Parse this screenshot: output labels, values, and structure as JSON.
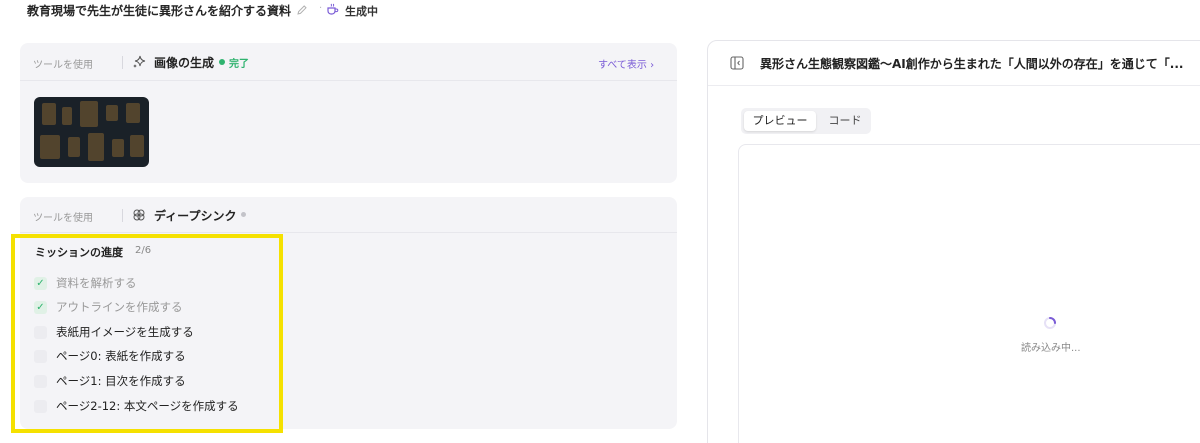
{
  "header": {
    "title": "教育現場で先生が生徒に異形さんを紹介する資料",
    "status": "生成中",
    "icons": {
      "edit": "pencil-icon",
      "status": "cup-icon"
    }
  },
  "tool_image": {
    "tool_use_label": "ツールを使用",
    "tool_name": "画像の生成",
    "status": "完了",
    "show_all": "すべて表示",
    "icon": "sparkle-icon",
    "status_color": "#2fb36f"
  },
  "tool_think": {
    "tool_use_label": "ツールを使用",
    "tool_name": "ディープシンク",
    "icon": "atom-icon"
  },
  "mission": {
    "title": "ミッションの進度",
    "progress": "2/6",
    "items": [
      {
        "label": "資料を解析する",
        "done": true
      },
      {
        "label": "アウトラインを作成する",
        "done": true
      },
      {
        "label": "表紙用イメージを生成する",
        "done": false
      },
      {
        "label": "ページ0: 表紙を作成する",
        "done": false
      },
      {
        "label": "ページ1: 目次を作成する",
        "done": false
      },
      {
        "label": "ページ2-12: 本文ページを作成する",
        "done": false
      }
    ]
  },
  "preview_panel": {
    "title": "異形さん生態観察図鑑〜AI創作から生まれた「人間以外の存在」を通じて「...",
    "tabs": [
      "プレビュー",
      "コード"
    ],
    "loading": "読み込み中...",
    "accent": "#7a5bd6",
    "highlight_color": "#f5e100"
  }
}
